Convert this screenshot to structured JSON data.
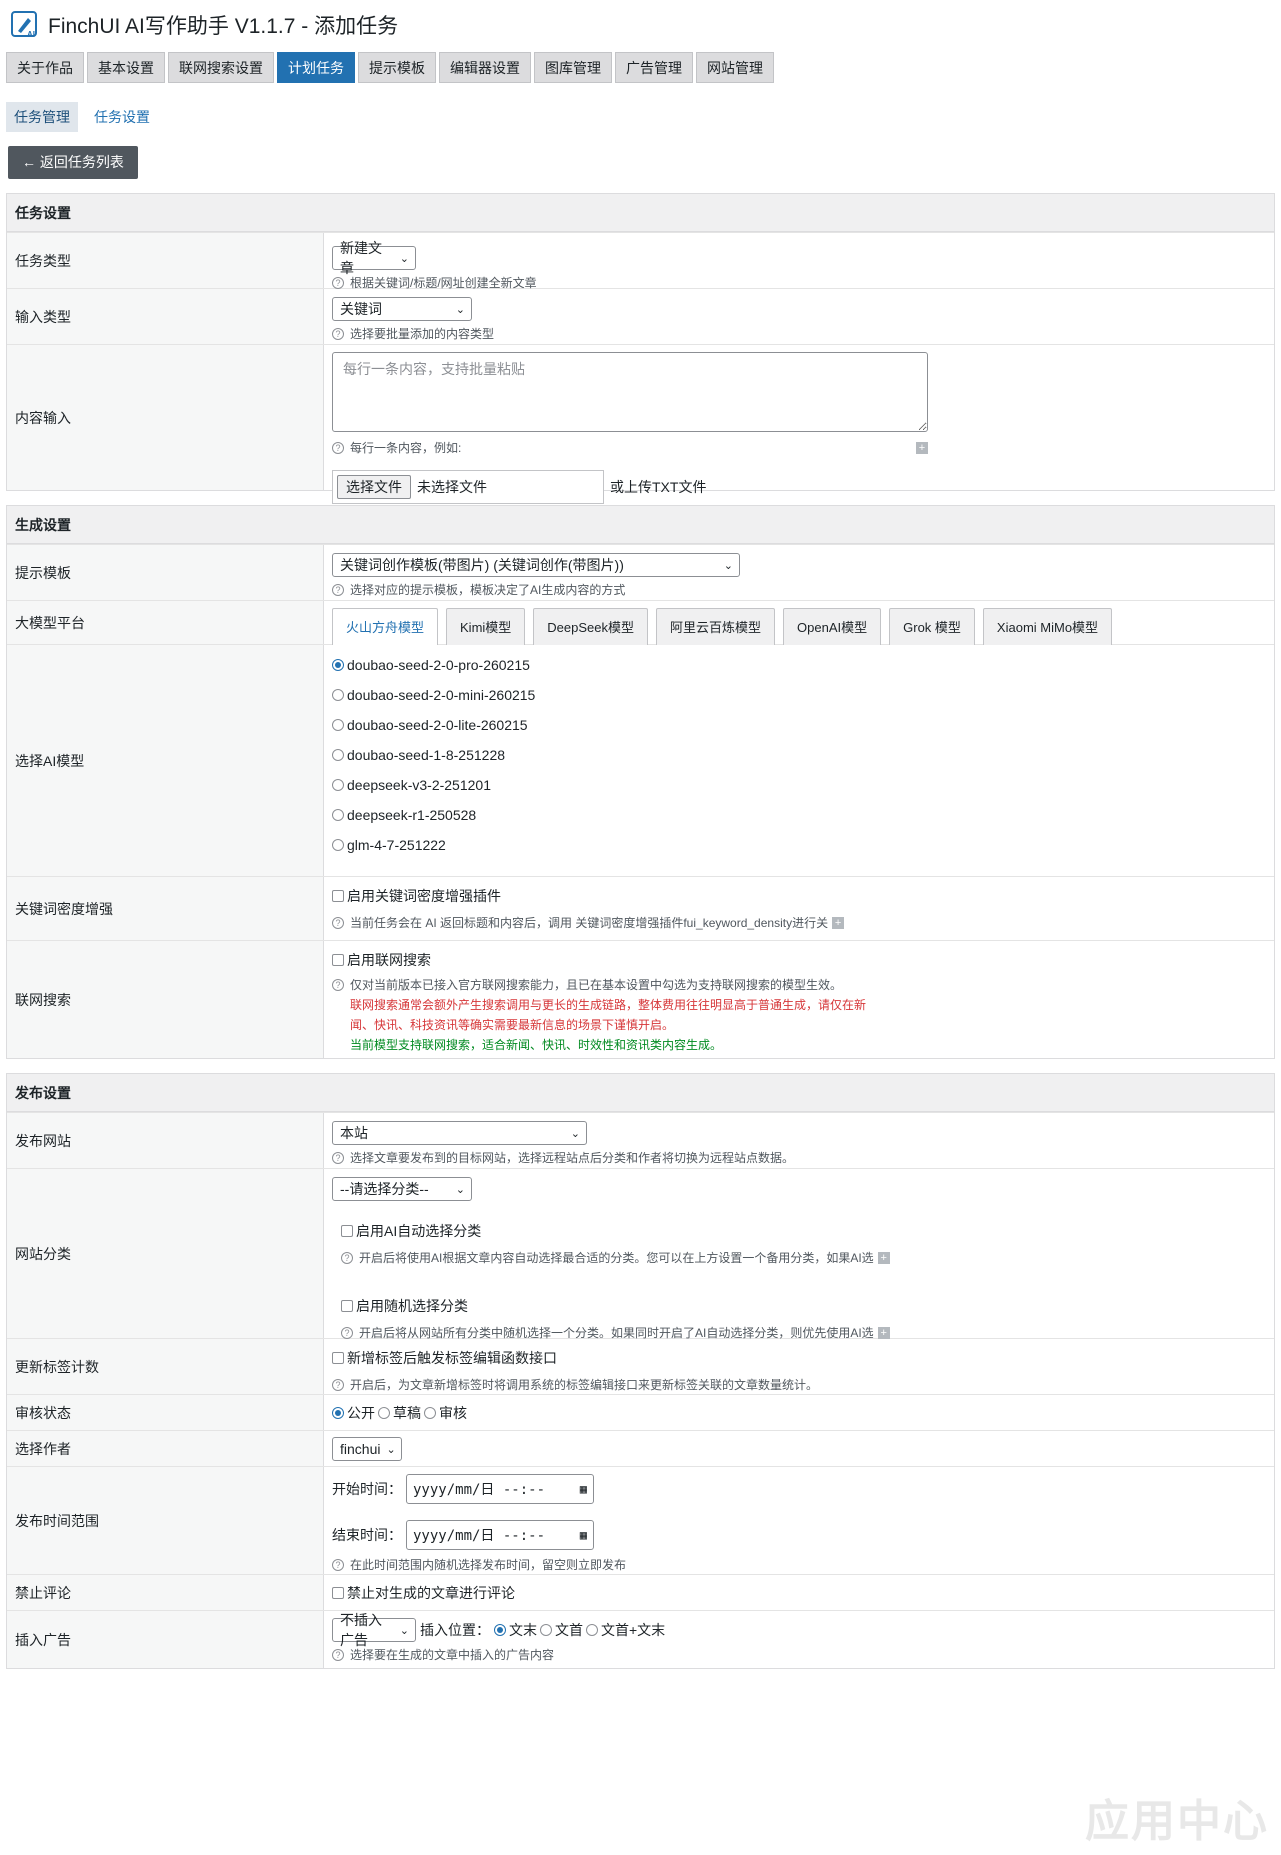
{
  "app": {
    "title": "FinchUI AI写作助手 V1.1.7 - 添加任务"
  },
  "main_tabs": [
    {
      "label": "关于作品"
    },
    {
      "label": "基本设置"
    },
    {
      "label": "联网搜索设置"
    },
    {
      "label": "计划任务"
    },
    {
      "label": "提示模板"
    },
    {
      "label": "编辑器设置"
    },
    {
      "label": "图库管理"
    },
    {
      "label": "广告管理"
    },
    {
      "label": "网站管理"
    }
  ],
  "sub_tabs": [
    {
      "label": "任务管理"
    },
    {
      "label": "任务设置"
    }
  ],
  "back_button": "← 返回任务列表",
  "task_section": {
    "title": "任务设置",
    "task_type": {
      "label": "任务类型",
      "value": "新建文章",
      "help": "根据关键词/标题/网址创建全新文章"
    },
    "input_type": {
      "label": "输入类型",
      "value": "关键词",
      "help": "选择要批量添加的内容类型"
    },
    "content_input": {
      "label": "内容输入",
      "placeholder": "每行一条内容，支持批量粘贴",
      "help": "每行一条内容，例如:",
      "file_button": "选择文件",
      "file_name": "未选择文件",
      "file_or": "或上传TXT文件"
    }
  },
  "gen_section": {
    "title": "生成设置",
    "template": {
      "label": "提示模板",
      "value": "关键词创作模板(带图片) (关键词创作(带图片))",
      "help": "选择对应的提示模板，模板决定了AI生成内容的方式"
    },
    "platform": {
      "label": "大模型平台",
      "tabs": [
        {
          "label": "火山方舟模型"
        },
        {
          "label": "Kimi模型"
        },
        {
          "label": "DeepSeek模型"
        },
        {
          "label": "阿里云百炼模型"
        },
        {
          "label": "OpenAI模型"
        },
        {
          "label": "Grok 模型"
        },
        {
          "label": "Xiaomi MiMo模型"
        }
      ]
    },
    "model": {
      "label": "选择AI模型",
      "options": [
        {
          "label": "doubao-seed-2-0-pro-260215"
        },
        {
          "label": "doubao-seed-2-0-mini-260215"
        },
        {
          "label": "doubao-seed-2-0-lite-260215"
        },
        {
          "label": "doubao-seed-1-8-251228"
        },
        {
          "label": "deepseek-v3-2-251201"
        },
        {
          "label": "deepseek-r1-250528"
        },
        {
          "label": "glm-4-7-251222"
        }
      ]
    },
    "density": {
      "label": "关键词密度增强",
      "check": "启用关键词密度增强插件",
      "help": "当前任务会在 AI 返回标题和内容后，调用 关键词密度增强插件fui_keyword_density进行关"
    },
    "web_search": {
      "label": "联网搜索",
      "check": "启用联网搜索",
      "help": "仅对当前版本已接入官方联网搜索能力，且已在基本设置中勾选为支持联网搜索的模型生效。",
      "warn_line1": "联网搜索通常会额外产生搜索调用与更长的生成链路，整体费用往往明显高于普通生成，请仅在新",
      "warn_line2": "闻、快讯、科技资讯等确实需要最新信息的场景下谨慎开启。",
      "ok": "当前模型支持联网搜索，适合新闻、快讯、时效性和资讯类内容生成。"
    }
  },
  "pub_section": {
    "title": "发布设置",
    "site": {
      "label": "发布网站",
      "value": "本站",
      "help": "选择文章要发布到的目标网站，选择远程站点后分类和作者将切换为远程站点数据。"
    },
    "category": {
      "label": "网站分类",
      "value": "--请选择分类--",
      "ai_check": "启用AI自动选择分类",
      "ai_help": "开启后将使用AI根据文章内容自动选择最合适的分类。您可以在上方设置一个备用分类，如果AI选",
      "rand_check": "启用随机选择分类",
      "rand_help": "开启后将从网站所有分类中随机选择一个分类。如果同时开启了AI自动选择分类，则优先使用AI选"
    },
    "tag_count": {
      "label": "更新标签计数",
      "check": "新增标签后触发标签编辑函数接口",
      "help": "开启后，为文章新增标签时将调用系统的标签编辑接口来更新标签关联的文章数量统计。"
    },
    "review": {
      "label": "审核状态",
      "options": [
        {
          "label": "公开"
        },
        {
          "label": "草稿"
        },
        {
          "label": "审核"
        }
      ]
    },
    "author": {
      "label": "选择作者",
      "value": "finchui"
    },
    "time_range": {
      "label": "发布时间范围",
      "start_label": "开始时间：",
      "end_label": "结束时间：",
      "date_placeholder": "yyyy/mm/日  --:--",
      "help": "在此时间范围内随机选择发布时间，留空则立即发布"
    },
    "comments": {
      "label": "禁止评论",
      "check": "禁止对生成的文章进行评论"
    },
    "ads": {
      "label": "插入广告",
      "value": "不插入广告",
      "pos_label": "插入位置：",
      "positions": [
        {
          "label": "文末"
        },
        {
          "label": "文首"
        },
        {
          "label": "文首+文末"
        }
      ],
      "help": "选择要在生成的文章中插入的广告内容"
    }
  },
  "watermark": "应用中心",
  "colors": {
    "accent": "#2271b1",
    "warn": "#d63638",
    "ok": "#008a20"
  }
}
